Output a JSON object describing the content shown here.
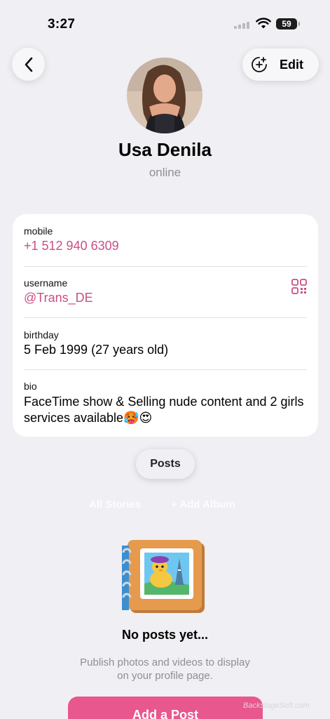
{
  "status_bar": {
    "time": "3:27",
    "battery": "59"
  },
  "header": {
    "edit_label": "Edit"
  },
  "profile": {
    "name": "Usa Denila",
    "presence": "online"
  },
  "info": {
    "mobile_label": "mobile",
    "mobile_value": "+1 512 940 6309",
    "username_label": "username",
    "username_value": "@Trans_DE",
    "birthday_label": "birthday",
    "birthday_value": "5 Feb 1999 (27 years old)",
    "bio_label": "bio",
    "bio_value": "FaceTime show & Selling nude content and 2 girls services available🥵😍"
  },
  "tabs": {
    "posts": "Posts",
    "all_stories": "All Stories",
    "add_album": "+ Add Album"
  },
  "empty_state": {
    "title": "No posts yet...",
    "description": "Publish photos and videos to display on your profile page.",
    "button": "Add a Post"
  },
  "watermark": "BackstageSoft.com",
  "colors": {
    "accent": "#c94f86",
    "button": "#e8578d",
    "background": "#efeff4"
  }
}
